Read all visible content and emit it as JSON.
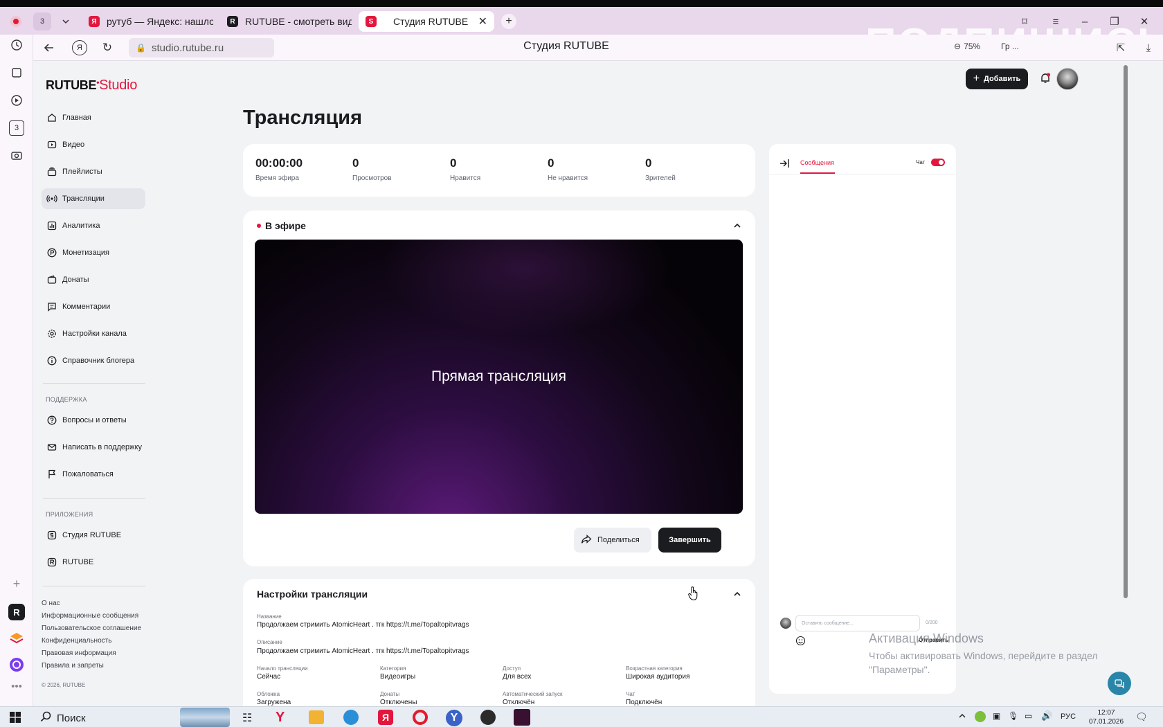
{
  "browser": {
    "tab_counter": "3",
    "tabs": [
      {
        "label": "рутуб — Яндекс: нашлось",
        "favicon": "Я",
        "color": "#e2173e"
      },
      {
        "label": "RUTUBE - смотреть виде",
        "favicon": "R",
        "color": "#1b1c1f"
      },
      {
        "label": "Студия RUTUBE",
        "favicon": "S",
        "color": "#e2173e"
      }
    ],
    "url": "studio.rutube.ru",
    "page_title": "Студия RUTUBE",
    "zoom": "75%",
    "extra_label": "Гр ...",
    "watermark": "ПОДПИШИСЬ",
    "rail_badge": "3"
  },
  "sidebar": {
    "logo_main": "RUTUBE",
    "logo_sub": "Studio",
    "items": [
      {
        "label": "Главная",
        "icon": "home-icon"
      },
      {
        "label": "Видео",
        "icon": "video-icon"
      },
      {
        "label": "Плейлисты",
        "icon": "playlist-icon"
      },
      {
        "label": "Трансляции",
        "icon": "broadcast-icon"
      },
      {
        "label": "Аналитика",
        "icon": "analytics-icon"
      },
      {
        "label": "Монетизация",
        "icon": "monetization-icon"
      },
      {
        "label": "Донаты",
        "icon": "wallet-icon"
      },
      {
        "label": "Комментарии",
        "icon": "comment-icon"
      },
      {
        "label": "Настройки канала",
        "icon": "gear-icon"
      },
      {
        "label": "Справочник блогера",
        "icon": "info-icon"
      }
    ],
    "support_heading": "ПОДДЕРЖКА",
    "support_items": [
      {
        "label": "Вопросы и ответы",
        "icon": "question-icon"
      },
      {
        "label": "Написать в поддержку",
        "icon": "mail-icon"
      },
      {
        "label": "Пожаловаться",
        "icon": "flag-icon"
      }
    ],
    "apps_heading": "ПРИЛОЖЕНИЯ",
    "apps_items": [
      {
        "label": "Студия RUTUBE",
        "icon": "studio-app-icon"
      },
      {
        "label": "RUTUBE",
        "icon": "rutube-app-icon"
      }
    ],
    "footer_links": [
      "О нас",
      "Информационные сообщения",
      "Пользовательское соглашение",
      "Конфиденциальность",
      "Правовая информация",
      "Правила и запреты"
    ],
    "copyright": "© 2026, RUTUBE"
  },
  "header": {
    "add_button": "Добавить"
  },
  "main": {
    "title": "Трансляция",
    "stats": [
      {
        "value": "00:00:00",
        "label": "Время эфира"
      },
      {
        "value": "0",
        "label": "Просмотров"
      },
      {
        "value": "0",
        "label": "Нравится"
      },
      {
        "value": "0",
        "label": "Не нравится"
      },
      {
        "value": "0",
        "label": "Зрителей"
      }
    ],
    "live": {
      "title": "В эфире",
      "player_text": "Прямая трансляция",
      "share_button": "Поделиться",
      "end_button": "Завершить"
    },
    "settings": {
      "title": "Настройки трансляции",
      "name_label": "Название",
      "name_value": "Продолжаем стримить AtomicHeart . тгк https://t.me/Topaltopitvrags",
      "desc_label": "Описание",
      "desc_value": "Продолжаем стримить AtomicHeart . тгк https://t.me/Topaltopitvrags",
      "fields": [
        {
          "label": "Начало трансляции",
          "value": "Сейчас"
        },
        {
          "label": "Категория",
          "value": "Видеоигры"
        },
        {
          "label": "Доступ",
          "value": "Для всех"
        },
        {
          "label": "Возрастная категория",
          "value": "Широкая аудитория"
        },
        {
          "label": "Обложка",
          "value": "Загружена"
        },
        {
          "label": "Донаты",
          "value": "Отключены"
        },
        {
          "label": "Автоматический запуск",
          "value": "Отключён"
        },
        {
          "label": "Чат",
          "value": "Подключён"
        }
      ]
    }
  },
  "chat": {
    "tab_label": "Сообщения",
    "toggle_label": "Чат",
    "input_placeholder": "Оставить сообщение...",
    "counter": "0/200",
    "send_label": "Отправить"
  },
  "windows": {
    "activate_title": "Активация Windows",
    "activate_text_1": "Чтобы активировать Windows, перейдите в раздел",
    "activate_text_2": "\"Параметры\".",
    "search_label": "Поиск",
    "lang": "РУС",
    "time": "12:07",
    "date": "07.01.2026"
  },
  "colors": {
    "accent": "#e2173e",
    "dark": "#1b1c1f",
    "page_bg": "#f2f3f5"
  }
}
